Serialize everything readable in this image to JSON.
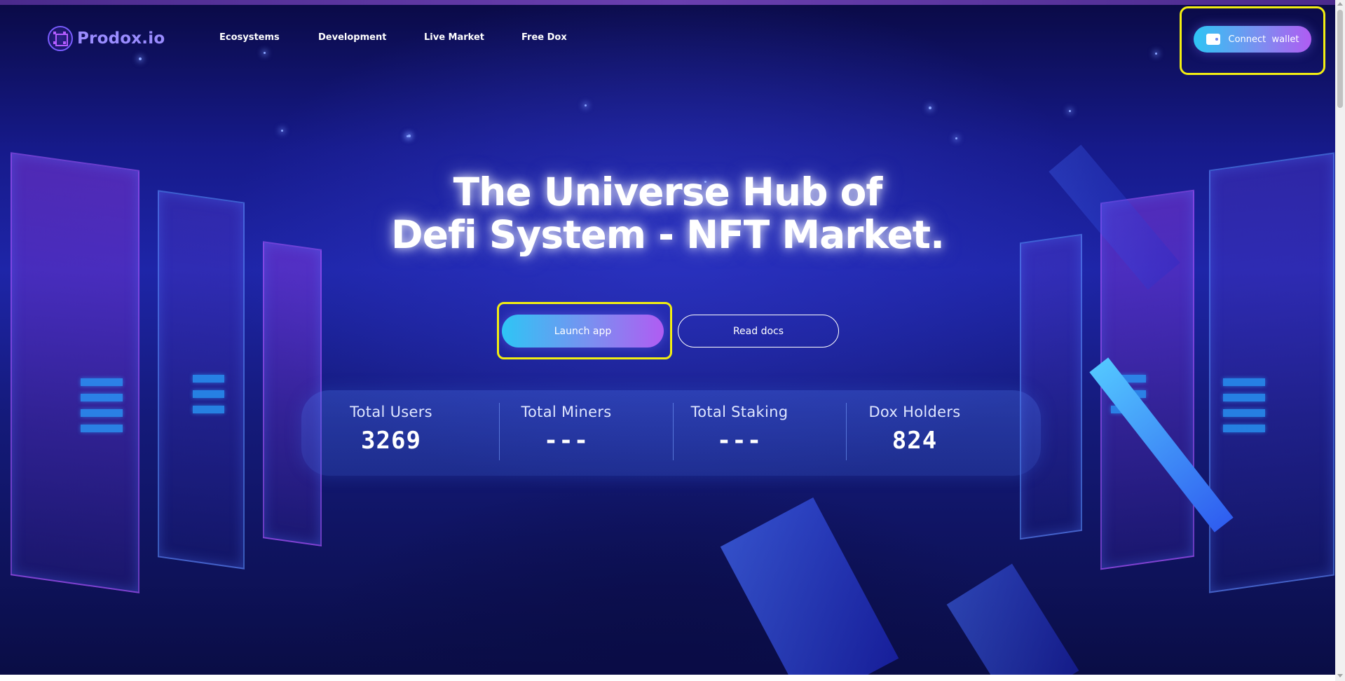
{
  "brand": {
    "name": "Prodox.io"
  },
  "nav": {
    "links": [
      "Ecosystems",
      "Development",
      "Live Market",
      "Free Dox"
    ]
  },
  "header": {
    "connect_wallet_label": "Connect  wallet"
  },
  "hero": {
    "title_line1": "The Universe Hub of",
    "title_line2": "Defi System - NFT Market.",
    "launch_label": "Launch app",
    "docs_label": "Read docs"
  },
  "stats": [
    {
      "label": "Total Users",
      "value": "3269"
    },
    {
      "label": "Total Miners",
      "value": "---"
    },
    {
      "label": "Total Staking",
      "value": "---"
    },
    {
      "label": "Dox Holders",
      "value": "824"
    }
  ],
  "colors": {
    "accent_start": "#2ec5f5",
    "accent_end": "#b05cf2",
    "highlight": "#f2ee12",
    "background": "#161a8a"
  },
  "icons": {
    "logo": "prodox-logo-icon",
    "wallet": "wallet-icon"
  }
}
